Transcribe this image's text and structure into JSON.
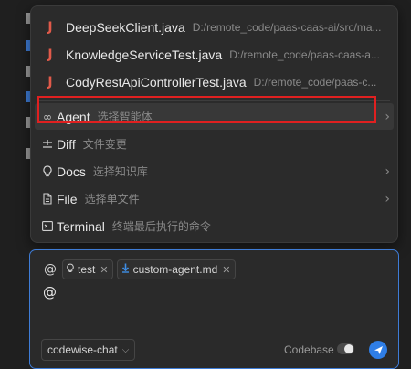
{
  "colors": {
    "accent": "#2f7ee6",
    "highlight_border": "#e02020",
    "java_icon": "#e15a4a",
    "chip_file_icon": "#3e8ee6"
  },
  "files": [
    {
      "icon": "java-icon",
      "name": "DeepSeekClient.java",
      "path": "D:/remote_code/paas-caas-ai/src/ma..."
    },
    {
      "icon": "java-icon",
      "name": "KnowledgeServiceTest.java",
      "path": "D:/remote_code/paas-caas-a..."
    },
    {
      "icon": "java-icon",
      "name": "CodyRestApiControllerTest.java",
      "path": "D:/remote_code/paas-c..."
    }
  ],
  "menu": [
    {
      "icon": "infinity-icon",
      "label": "Agent",
      "desc": "选择智能体",
      "has_submenu": true,
      "active": true
    },
    {
      "icon": "diff-icon",
      "label": "Diff",
      "desc": "文件变更",
      "has_submenu": false,
      "active": false
    },
    {
      "icon": "bulb-icon",
      "label": "Docs",
      "desc": "选择知识库",
      "has_submenu": true,
      "active": false
    },
    {
      "icon": "file-icon",
      "label": "File",
      "desc": "选择单文件",
      "has_submenu": true,
      "active": false
    },
    {
      "icon": "terminal-icon",
      "label": "Terminal",
      "desc": "终端最后执行的命令",
      "has_submenu": false,
      "active": false
    }
  ],
  "chat": {
    "mention_symbol": "@",
    "context_chips": [
      {
        "icon": "bulb-icon",
        "label": "test"
      },
      {
        "icon": "download-file-icon",
        "label": "custom-agent.md"
      }
    ],
    "input_value": "@",
    "model": "codewise-chat",
    "codebase_label": "Codebase",
    "codebase_enabled": false
  }
}
